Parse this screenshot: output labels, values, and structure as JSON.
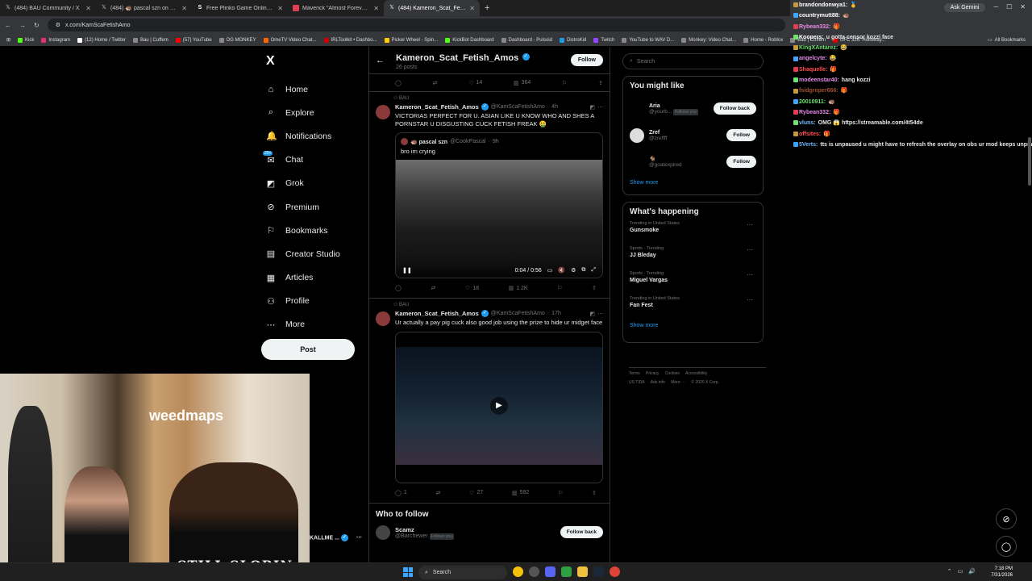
{
  "browser": {
    "tabs": [
      {
        "label": "(484) BAU Community / X",
        "icon": "x-icon",
        "active": false
      },
      {
        "label": "(484) 🦔 pascal szn on X: \"bro",
        "icon": "x-icon",
        "active": false
      },
      {
        "label": "Free Plinko Game Online - Play",
        "icon": "s-icon",
        "active": false
      },
      {
        "label": "Maverick \"Almost Forever\" Ep",
        "icon": "video-icon",
        "active": false
      },
      {
        "label": "(484) Kameron_Scat_Fetish_Amo",
        "icon": "x-icon",
        "active": true
      }
    ],
    "new_tab": "+",
    "url": "x.com/KamScaFetishAmo",
    "ask_gemini": "Ask Gemini",
    "bookmarks": [
      "Kick",
      "Instagram",
      "(12) Home / Twitter",
      "Bau | Cuffem",
      "(57) YouTube",
      "OG MONKEY",
      "OmeTV Video Chat...",
      "IRLToolkit • Dashbo...",
      "Picker Wheel - Spin...",
      "KickBot Dashboard",
      "Dashboard - Pulsoid",
      "DistroKid",
      "Twitch",
      "YouTube to WAV D...",
      "Monkey: Video Chat...",
      "Home - Roblox",
      "Bau | Cuffem",
      "UFC 326: Holloway..."
    ],
    "all_bookmarks": "All Bookmarks"
  },
  "nav": {
    "logo": "X",
    "items": [
      {
        "label": "Home",
        "icon": "home-icon",
        "glyph": "⌂"
      },
      {
        "label": "Explore",
        "icon": "search-icon",
        "glyph": "⌕"
      },
      {
        "label": "Notifications",
        "icon": "bell-icon",
        "glyph": "🔔"
      },
      {
        "label": "Chat",
        "icon": "chat-icon",
        "glyph": "✉"
      },
      {
        "label": "Grok",
        "icon": "grok-icon",
        "glyph": "◩"
      },
      {
        "label": "Premium",
        "icon": "premium-icon",
        "glyph": "⊘"
      },
      {
        "label": "Bookmarks",
        "icon": "bookmark-icon",
        "glyph": "⚐"
      },
      {
        "label": "Creator Studio",
        "icon": "creator-icon",
        "glyph": "▤"
      },
      {
        "label": "Articles",
        "icon": "articles-icon",
        "glyph": "▦"
      },
      {
        "label": "Profile",
        "icon": "profile-icon",
        "glyph": "⚇"
      },
      {
        "label": "More",
        "icon": "more-icon",
        "glyph": "⋯"
      }
    ],
    "post": "Post",
    "chat_badge": "20+"
  },
  "profile": {
    "name": "Kameron_Scat_Fetish_Amos",
    "posts": "26 posts",
    "follow": "Follow"
  },
  "top_actions": {
    "likes": "14",
    "views": "364"
  },
  "tweets": [
    {
      "community": "BAU",
      "name": "Kameron_Scat_Fetish_Amos",
      "handle": "@KamScaFetishAmo",
      "time": "4h",
      "text": "VICTORIAS PERFECT FOR U. ASIAN LIKE U KNOW WHO AND SHES A PORNSTAR U DISGUSTING CUCK FETISH FREAK 🤮",
      "quote": {
        "name": "🦔 pascal szn",
        "handle": "@CookPascal",
        "time": "9h",
        "text": "bro im crying",
        "video_time": "0:04 / 0:56"
      },
      "likes": "18",
      "views": "1.2K"
    },
    {
      "community": "BAU",
      "name": "Kameron_Scat_Fetish_Amos",
      "handle": "@KamScaFetishAmo",
      "time": "17h",
      "text": "Ur actually a pay pig cuck also good job using the prize to hide ur midget face",
      "replies": "1",
      "likes": "27",
      "views": "592"
    }
  ],
  "who_to_follow": {
    "title": "Who to follow",
    "name": "Scamz",
    "handle": "@Barchewer",
    "follows_you": "Follows you",
    "button": "Follow back"
  },
  "sidebar": {
    "search_placeholder": "Search",
    "you_might_like": {
      "title": "You might like",
      "users": [
        {
          "name": "Aria",
          "handle": "@yourb...",
          "follows_you": "Follows you",
          "button": "Follow back"
        },
        {
          "name": "Zref",
          "handle": "@zreffff",
          "button": "Follow"
        },
        {
          "name": "🐐",
          "handle": "@goatexpired",
          "button": "Follow"
        }
      ],
      "show_more": "Show more"
    },
    "whats_happening": {
      "title": "What's happening",
      "trends": [
        {
          "context": "Trending in United States",
          "topic": "Gunsmoke"
        },
        {
          "context": "Sports · Trending",
          "topic": "JJ Bleday"
        },
        {
          "context": "Sports · Trending",
          "topic": "Miguel Vargas"
        },
        {
          "context": "Trending in United States",
          "topic": "Fan Fest"
        }
      ],
      "show_more": "Show more"
    },
    "footer": [
      "Terms",
      "Privacy",
      "Cookies",
      "Accessibility",
      "US TIDA",
      "Ads info",
      "More ···",
      "© 2026 X Corp."
    ]
  },
  "chat": [
    {
      "user": "brandondonwya1:",
      "msg": "🥇",
      "color": "#ffffff"
    },
    {
      "user": "countrymutt88:",
      "msg": "🦔",
      "color": "#ffffff"
    },
    {
      "user": "Rybean332:",
      "msg": "🎁",
      "color": "#e58be6"
    },
    {
      "user": "Koopers:",
      "msg": "u gotta censor kozzi face",
      "color": "#ffffff"
    },
    {
      "user": "KingXAntarez:",
      "msg": "😂",
      "color": "#6fe36f"
    },
    {
      "user": "angelcyte:",
      "msg": "😂",
      "color": "#e58be6"
    },
    {
      "user": "Shaquelle:",
      "msg": "🎁",
      "color": "#ff5252"
    },
    {
      "user": "modeenstar40:",
      "msg": "hang kozzi",
      "color": "#e58be6"
    },
    {
      "user": "fsidgroper666:",
      "msg": "🎁",
      "color": "#a0522d"
    },
    {
      "user": "20010911:",
      "msg": "🦔",
      "color": "#6fe36f"
    },
    {
      "user": "Rybean332:",
      "msg": "🎁",
      "color": "#e58be6"
    },
    {
      "user": "vluns:",
      "msg": "OMG 😱 https://streamable.com/4t54de",
      "color": "#6fb8ff"
    },
    {
      "user": "offsites:",
      "msg": "🎁",
      "color": "#ff5252"
    },
    {
      "user": "5Verts:",
      "msg": "tts is unpaused u might have to refresh the overlay on obs ur mod keeps unpinning @cuffem .",
      "color": "#6fb8ff"
    }
  ],
  "webcam": {
    "sign": "weedmaps",
    "shirt": "STILL SLORIN",
    "callme": "KALLME ..."
  },
  "taskbar": {
    "search": "Search",
    "time": "7:18 PM",
    "date": "7/31/2026"
  },
  "colors": {
    "accent": "#1d9bf0",
    "background": "#000000",
    "text": "#e7e9ea",
    "muted": "#71767b"
  }
}
